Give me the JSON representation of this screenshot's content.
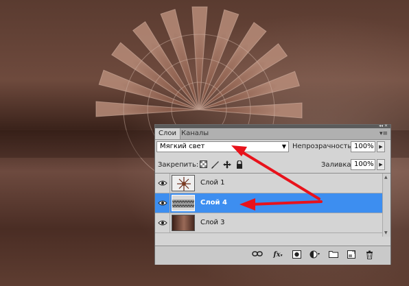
{
  "panel": {
    "tabs": [
      {
        "label": "Слои",
        "active": true
      },
      {
        "label": "Каналы",
        "active": false
      }
    ],
    "blend_mode": "Мягкий свет",
    "opacity_label": "Непрозрачность:",
    "opacity_value": "100%",
    "lock_label": "Закрепить:",
    "fill_label": "Заливка:",
    "fill_value": "100%",
    "layers": [
      {
        "name": "Слой 1",
        "selected": false,
        "visible": true
      },
      {
        "name": "Слой 4",
        "selected": true,
        "visible": true
      },
      {
        "name": "Слой 3",
        "selected": false,
        "visible": true
      }
    ],
    "footer_fx_label": "fx"
  },
  "colors": {
    "selection": "#3d8ef0",
    "annotation_arrow": "#e8121b",
    "background": "#4a2a20"
  }
}
